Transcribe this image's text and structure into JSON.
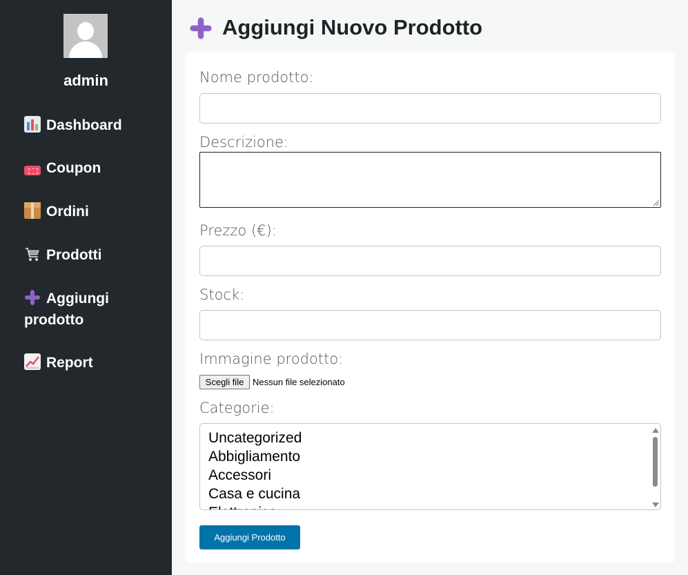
{
  "sidebar": {
    "username": "admin",
    "items": [
      {
        "label": "Dashboard",
        "icon": "bar-chart-icon"
      },
      {
        "label": "Coupon",
        "icon": "ticket-icon"
      },
      {
        "label": "Ordini",
        "icon": "package-icon"
      },
      {
        "label": "Prodotti",
        "icon": "shopping-cart-icon"
      },
      {
        "label": "Aggiungi prodotto",
        "icon": "plus-icon"
      },
      {
        "label": "Report",
        "icon": "trending-chart-icon"
      }
    ]
  },
  "page": {
    "title": "Aggiungi Nuovo Prodotto",
    "title_icon": "plus-icon"
  },
  "form": {
    "name_label": "Nome prodotto:",
    "name_value": "",
    "description_label": "Descrizione:",
    "description_value": "",
    "price_label": "Prezzo (€):",
    "price_value": "",
    "stock_label": "Stock:",
    "stock_value": "",
    "image_label": "Immagine prodotto:",
    "file_button": "Scegli file",
    "file_status": "Nessun file selezionato",
    "categories_label": "Categorie:",
    "categories": [
      "Uncategorized",
      "Abbigliamento",
      "Accessori",
      "Casa e cucina",
      "Elettronica"
    ],
    "submit_label": "Aggiungi Prodotto"
  },
  "colors": {
    "sidebar_bg": "#23282d",
    "accent": "#0073aa",
    "plus_icon": "#8e63c9"
  }
}
